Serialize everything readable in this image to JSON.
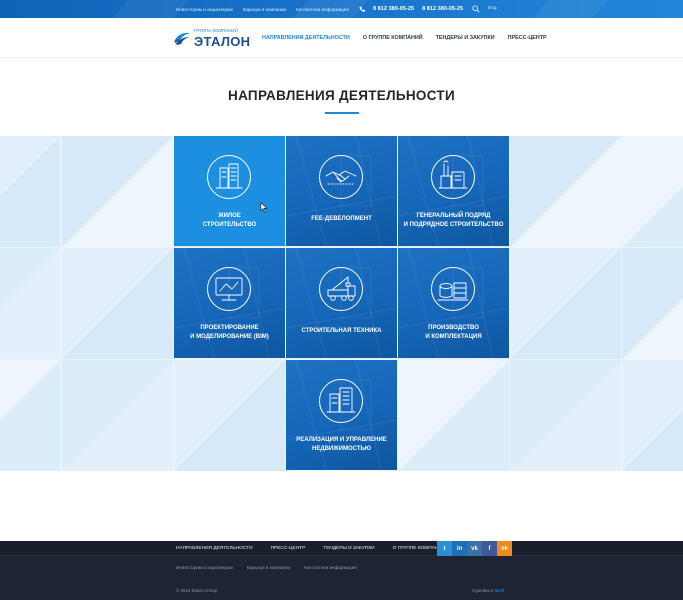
{
  "topbar": {
    "links": [
      "Инвесторам и акционерам",
      "Карьера в компании",
      "Контактная информация"
    ],
    "phones": [
      "8 812 380-05-25",
      "8 812 380-05-25"
    ],
    "lang": "Eng"
  },
  "header": {
    "logo_small": "ГРУППА КОМПАНИЙ",
    "logo_big": "ЭТАЛОН",
    "nav": [
      "НАПРАВЛЕНИЯ ДЕЯТЕЛЬНОСТИ",
      "О ГРУППЕ КОМПАНИЙ",
      "ТЕНДЕРЫ И ЗАКУПКИ",
      "ПРЕСС-ЦЕНТР"
    ],
    "active_index": 0
  },
  "page": {
    "title": "НАПРАВЛЕНИЯ ДЕЯТЕЛЬНОСТИ"
  },
  "tiles": [
    {
      "lines": [
        "ЖИЛОЕ",
        "СТРОИТЕЛЬСТВО"
      ],
      "icon": "residential-building-icon",
      "highlighted": true
    },
    {
      "lines": [
        "FEE-ДЕВЕЛОПМЕНТ"
      ],
      "icon": "handshake-icon",
      "highlighted": false
    },
    {
      "lines": [
        "ГЕНЕРАЛЬНЫЙ ПОДРЯД",
        "И ПОДРЯДНОЕ СТРОИТЕЛЬСТВО"
      ],
      "icon": "industrial-plant-icon",
      "highlighted": false
    },
    {
      "lines": [
        "ПРОЕКТИРОВАНИЕ",
        "И МОДЕЛИРОВАНИЕ (BIM)"
      ],
      "icon": "computer-monitor-icon",
      "highlighted": false
    },
    {
      "lines": [
        "СТРОИТЕЛЬНАЯ ТЕХНИКА"
      ],
      "icon": "crane-truck-icon",
      "highlighted": false
    },
    {
      "lines": [
        "ПРОИЗВОДСТВО",
        "И КОМПЛЕКТАЦИЯ"
      ],
      "icon": "materials-stack-icon",
      "highlighted": false
    },
    {
      "lines": [
        "РЕАЛИЗАЦИЯ И УПРАВЛЕНИЕ",
        "НЕДВИЖИМОСТЬЮ"
      ],
      "icon": "real-estate-building-icon",
      "highlighted": false
    }
  ],
  "footer": {
    "nav": [
      "НАПРАВЛЕНИЯ ДЕЯТЕЛЬНОСТИ",
      "ПРЕСС-ЦЕНТР",
      "ТЕНДЕРЫ И ЗАКУПКИ",
      "О ГРУППЕ КОМПАНИЙ"
    ],
    "social": [
      {
        "icon": "twitter-icon",
        "glyph": "t",
        "color": "#2b8fd6"
      },
      {
        "icon": "linkedin-icon",
        "glyph": "in",
        "color": "#1c6fb8"
      },
      {
        "icon": "vk-icon",
        "glyph": "vk",
        "color": "#3b6fa8"
      },
      {
        "icon": "facebook-icon",
        "glyph": "f",
        "color": "#3c5a98"
      },
      {
        "icon": "odnoklassniki-icon",
        "glyph": "ok",
        "color": "#f08c1c"
      }
    ],
    "links": [
      "Инвесторам и акционерам",
      "Карьера в компании",
      "Контактная информация"
    ],
    "copyright": "© 2015 Etalon Group",
    "made_by_prefix": "Сделано в",
    "made_by_name": "Itech"
  },
  "colors": {
    "accent": "#1f88d4",
    "tile_dark": "#1565b8",
    "tile_highlight": "#1d8fe0",
    "footer_bg": "#1e2431"
  }
}
